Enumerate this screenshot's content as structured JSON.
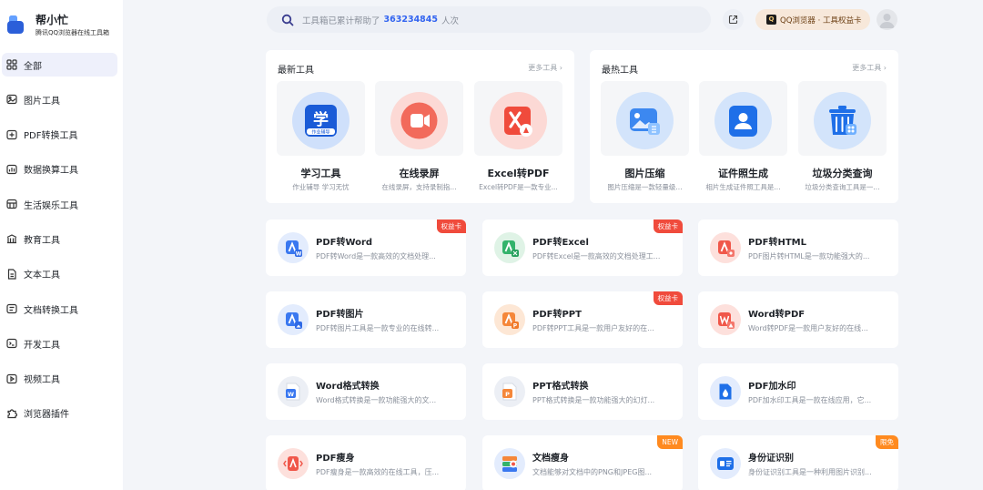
{
  "brand": {
    "title": "帮小忙",
    "subtitle": "腾讯QQ浏览器在线工具箱"
  },
  "nav": [
    {
      "label": "全部",
      "icon": "grid-icon",
      "active": true
    },
    {
      "label": "图片工具",
      "icon": "image-icon"
    },
    {
      "label": "PDF转换工具",
      "icon": "pdf-convert-icon"
    },
    {
      "label": "数据换算工具",
      "icon": "calculator-icon"
    },
    {
      "label": "生活娱乐工具",
      "icon": "entertainment-icon"
    },
    {
      "label": "教育工具",
      "icon": "education-icon"
    },
    {
      "label": "文本工具",
      "icon": "text-icon"
    },
    {
      "label": "文档转换工具",
      "icon": "doc-convert-icon"
    },
    {
      "label": "开发工具",
      "icon": "code-icon"
    },
    {
      "label": "视频工具",
      "icon": "video-icon"
    },
    {
      "label": "浏览器插件",
      "icon": "plugin-icon"
    }
  ],
  "search": {
    "prefix": "工具箱已累计帮助了",
    "count": "363234845",
    "suffix": "人次"
  },
  "header": {
    "rights_label": "QQ浏览器 · 工具权益卡",
    "qq_logo_text": "Q"
  },
  "panels": {
    "newest": {
      "title": "最新工具",
      "more": "更多工具 ›",
      "items": [
        {
          "title": "学习工具",
          "desc": "作业辅导 学习无忧",
          "icon": "study-icon"
        },
        {
          "title": "在线录屏",
          "desc": "在线录屏，支持录制指...",
          "icon": "screen-record-icon"
        },
        {
          "title": "Excel转PDF",
          "desc": "Excel转PDF是一款专业...",
          "icon": "excel-to-pdf-icon"
        }
      ]
    },
    "hottest": {
      "title": "最热工具",
      "more": "更多工具 ›",
      "items": [
        {
          "title": "图片压缩",
          "desc": "图片压缩是一款轻量级...",
          "icon": "image-compress-icon"
        },
        {
          "title": "证件照生成",
          "desc": "相片生成证件照工具是...",
          "icon": "id-photo-icon"
        },
        {
          "title": "垃圾分类查询",
          "desc": "垃圾分类查询工具是一...",
          "icon": "trash-sort-icon"
        }
      ]
    }
  },
  "study_icon_text": {
    "main": "学",
    "sub": "作业辅导"
  },
  "tools": [
    {
      "title": "PDF转Word",
      "desc": "PDF转Word是一款高效的文档处理...",
      "badge": "权益卡",
      "badge_color": "red",
      "icon": "pdf-to-word-icon"
    },
    {
      "title": "PDF转Excel",
      "desc": "PDF转Excel是一款高效的文档处理工...",
      "badge": "权益卡",
      "badge_color": "red",
      "icon": "pdf-to-excel-icon"
    },
    {
      "title": "PDF转HTML",
      "desc": "PDF图片转HTML是一款功能强大的...",
      "badge": "",
      "icon": "pdf-to-html-icon"
    },
    {
      "title": "PDF转图片",
      "desc": "PDF转图片工具是一款专业的在线转...",
      "badge": "",
      "icon": "pdf-to-image-icon"
    },
    {
      "title": "PDF转PPT",
      "desc": "PDF转PPT工具是一款用户友好的在...",
      "badge": "权益卡",
      "badge_color": "red",
      "icon": "pdf-to-ppt-icon"
    },
    {
      "title": "Word转PDF",
      "desc": "Word转PDF是一款用户友好的在线...",
      "badge": "",
      "icon": "word-to-pdf-icon"
    },
    {
      "title": "Word格式转换",
      "desc": "Word格式转换是一款功能强大的文...",
      "badge": "",
      "icon": "word-format-icon"
    },
    {
      "title": "PPT格式转换",
      "desc": "PPT格式转换是一款功能强大的幻灯...",
      "badge": "",
      "icon": "ppt-format-icon"
    },
    {
      "title": "PDF加水印",
      "desc": "PDF加水印工具是一款在线应用，它...",
      "badge": "",
      "icon": "pdf-watermark-icon"
    },
    {
      "title": "PDF瘦身",
      "desc": "PDF瘦身是一款高效的在线工具，压...",
      "badge": "",
      "icon": "pdf-slim-icon"
    },
    {
      "title": "文档瘦身",
      "desc": "文档能够对文档中的PNG和JPEG图...",
      "badge": "NEW",
      "badge_color": "orange",
      "icon": "doc-slim-icon"
    },
    {
      "title": "身份证识别",
      "desc": "身份证识别工具是一种利用图片识别...",
      "badge": "限免",
      "badge_color": "orange",
      "icon": "id-card-ocr-icon"
    }
  ],
  "colors": {
    "accent": "#3264f0",
    "badge_red": "#f04b3c",
    "badge_orange": "#ff8a1f",
    "nav_active_bg": "#eef0fb"
  }
}
